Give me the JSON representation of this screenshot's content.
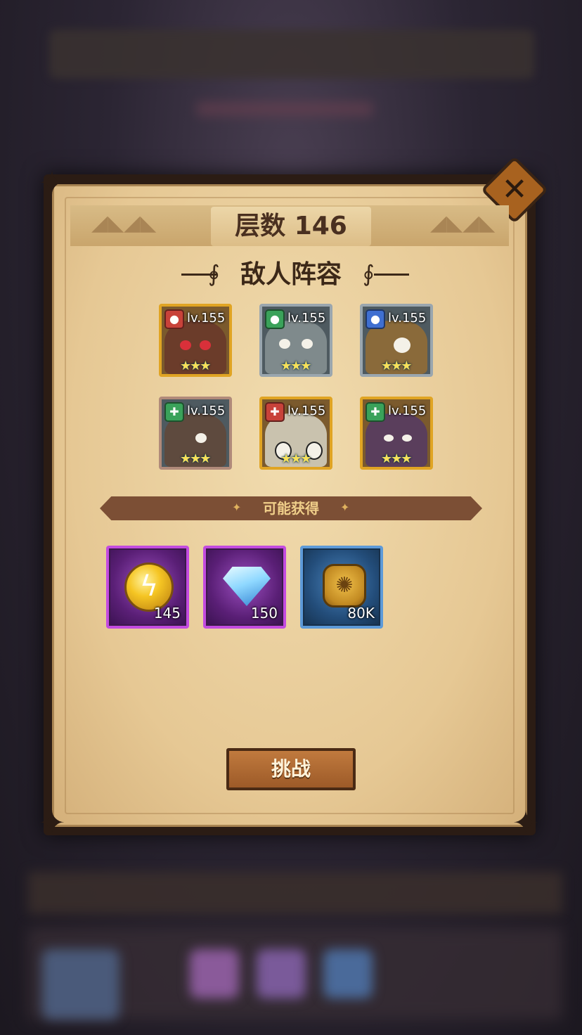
{
  "panel": {
    "floor_title": "层数 146",
    "enemy_section_title": "敌人阵容",
    "rewards_title": "可能获得",
    "challenge_label": "挑战"
  },
  "enemies": [
    {
      "level": "lv.155",
      "faction": "red",
      "stars": "★★★"
    },
    {
      "level": "lv.155",
      "faction": "green",
      "stars": "★★★"
    },
    {
      "level": "lv.155",
      "faction": "blue",
      "stars": "★★★"
    },
    {
      "level": "lv.155",
      "faction": "green-cross",
      "stars": "★★★"
    },
    {
      "level": "lv.155",
      "faction": "red-cross",
      "stars": "★★★"
    },
    {
      "level": "lv.155",
      "faction": "green-cross",
      "stars": "★★★"
    }
  ],
  "rewards": [
    {
      "item": "gold-orb-icon",
      "count": "145"
    },
    {
      "item": "diamond-icon",
      "count": "150"
    },
    {
      "item": "coin-icon",
      "count": "80K"
    }
  ],
  "colors": {
    "faction_red": "#c8423a",
    "faction_green": "#3aa25a",
    "faction_blue": "#3f6fd1",
    "card_gold": "#e0a423",
    "card_silver": "#9aa6ae"
  }
}
